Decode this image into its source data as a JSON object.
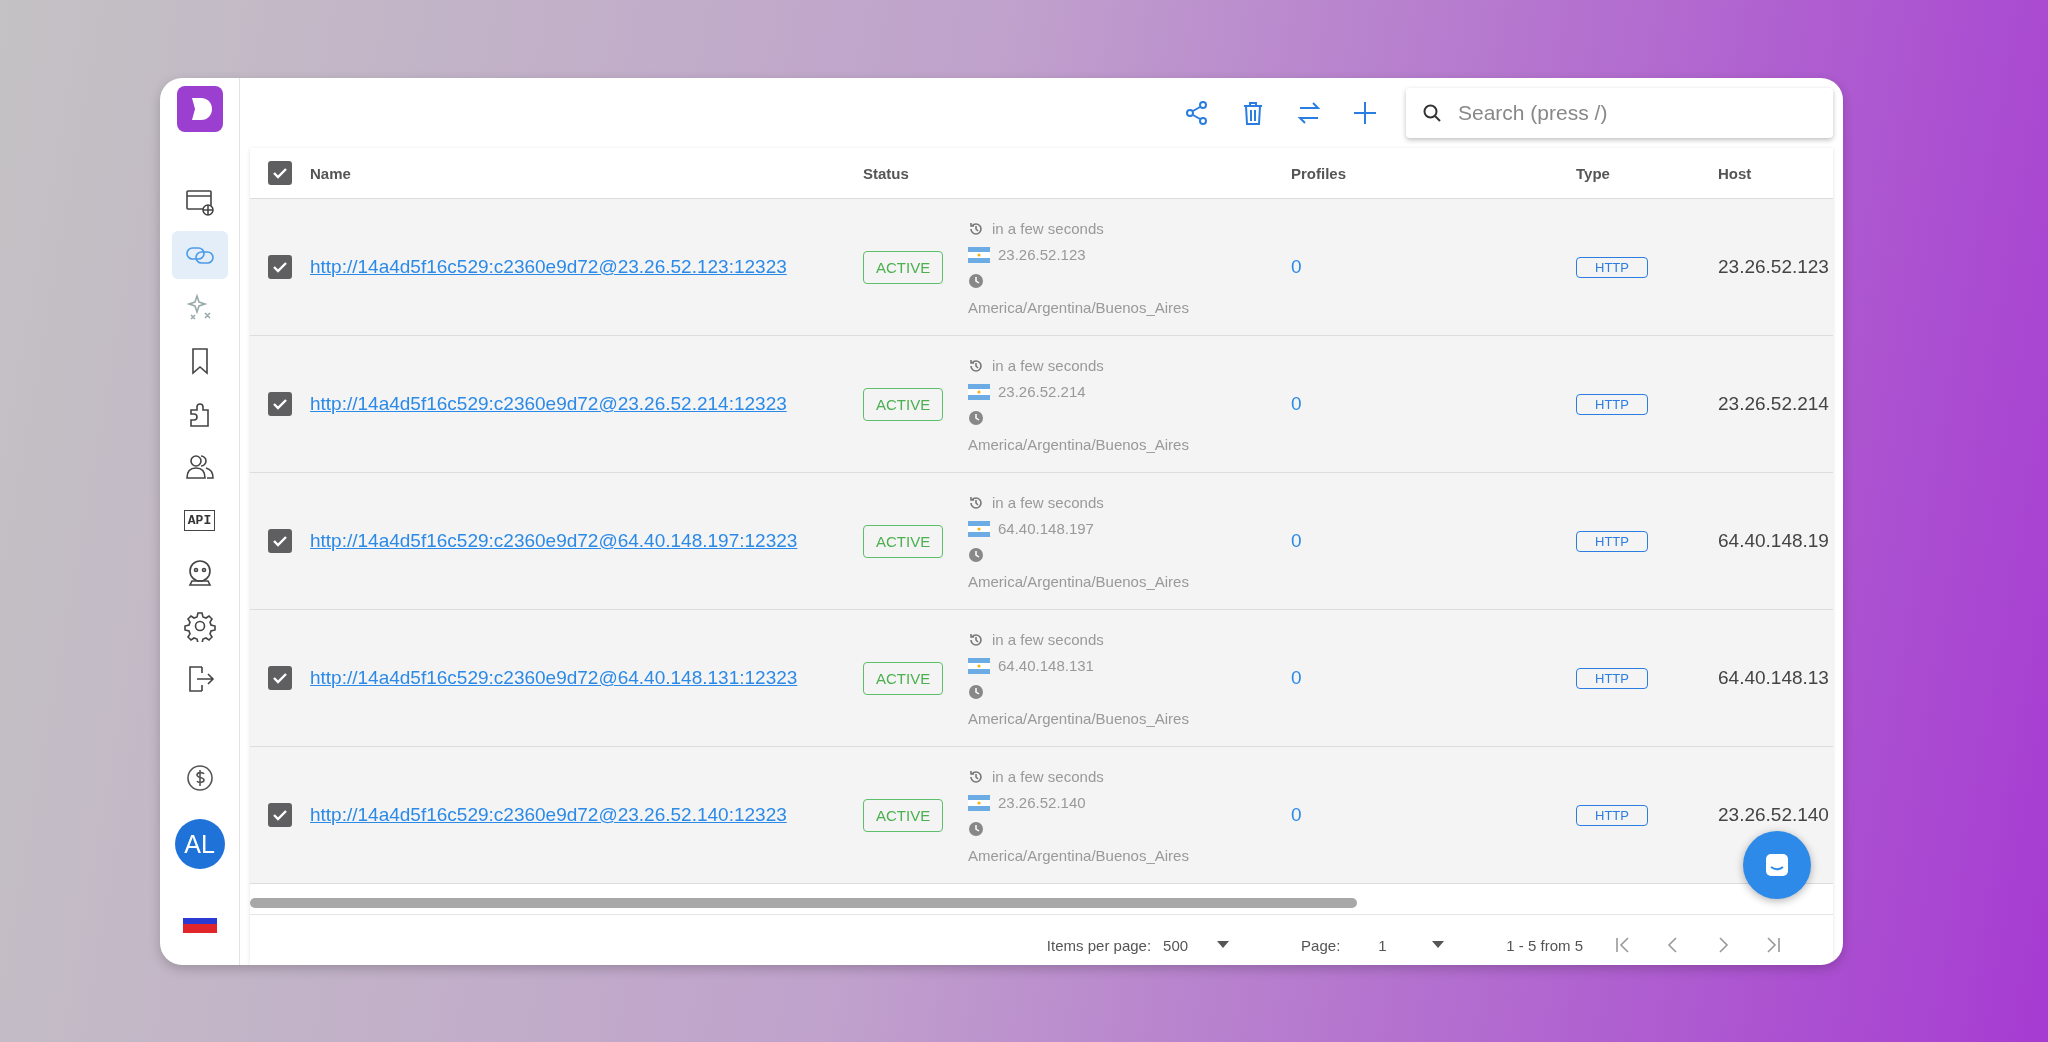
{
  "sidebar": {
    "logo": {
      "kind": "logo"
    },
    "items": [
      {
        "kind": "browser",
        "selected": false
      },
      {
        "kind": "link",
        "selected": true
      },
      {
        "kind": "sparkle",
        "selected": false
      },
      {
        "kind": "bookmark",
        "selected": false
      },
      {
        "kind": "puzzle",
        "selected": false
      },
      {
        "kind": "users",
        "selected": false
      },
      {
        "kind": "api",
        "label": "API",
        "selected": false
      },
      {
        "kind": "robot",
        "selected": false
      },
      {
        "kind": "gear",
        "selected": false
      },
      {
        "kind": "logout",
        "selected": false
      }
    ],
    "balance": {
      "kind": "dollar"
    },
    "avatar": "AL",
    "language": {
      "kind": "flag"
    }
  },
  "toolbar": {
    "buttons": [
      {
        "kind": "share"
      },
      {
        "kind": "delete"
      },
      {
        "kind": "swap"
      },
      {
        "kind": "add"
      }
    ],
    "search": {
      "placeholder": "Search (press /)"
    }
  },
  "table": {
    "select_all": {
      "checked": true
    },
    "columns": [
      "Name",
      "Status",
      "Profiles",
      "Type",
      "Host"
    ],
    "rows": [
      {
        "checked": true,
        "url": "http://14a4d5f16c529:c2360e9d72@23.26.52.123:12323",
        "status": "ACTIVE",
        "checked_at": "in a few seconds",
        "ip": "23.26.52.123",
        "timezone": "America/Argentina/Buenos_Aires",
        "profiles": "0",
        "type": "HTTP",
        "host": "23.26.52.123"
      },
      {
        "checked": true,
        "url": "http://14a4d5f16c529:c2360e9d72@23.26.52.214:12323",
        "status": "ACTIVE",
        "checked_at": "in a few seconds",
        "ip": "23.26.52.214",
        "timezone": "America/Argentina/Buenos_Aires",
        "profiles": "0",
        "type": "HTTP",
        "host": "23.26.52.214"
      },
      {
        "checked": true,
        "url": "http://14a4d5f16c529:c2360e9d72@64.40.148.197:12323",
        "status": "ACTIVE",
        "checked_at": "in a few seconds",
        "ip": "64.40.148.197",
        "timezone": "America/Argentina/Buenos_Aires",
        "profiles": "0",
        "type": "HTTP",
        "host": "64.40.148.19"
      },
      {
        "checked": true,
        "url": "http://14a4d5f16c529:c2360e9d72@64.40.148.131:12323",
        "status": "ACTIVE",
        "checked_at": "in a few seconds",
        "ip": "64.40.148.131",
        "timezone": "America/Argentina/Buenos_Aires",
        "profiles": "0",
        "type": "HTTP",
        "host": "64.40.148.13"
      },
      {
        "checked": true,
        "url": "http://14a4d5f16c529:c2360e9d72@23.26.52.140:12323",
        "status": "ACTIVE",
        "checked_at": "in a few seconds",
        "ip": "23.26.52.140",
        "timezone": "America/Argentina/Buenos_Aires",
        "profiles": "0",
        "type": "HTTP",
        "host": "23.26.52.140"
      }
    ]
  },
  "pagination": {
    "items_per_page_label": "Items per page:",
    "items_per_page": "500",
    "page_label": "Page:",
    "page": "1",
    "range": "1 - 5 from 5"
  },
  "chat": {
    "kind": "chat"
  }
}
